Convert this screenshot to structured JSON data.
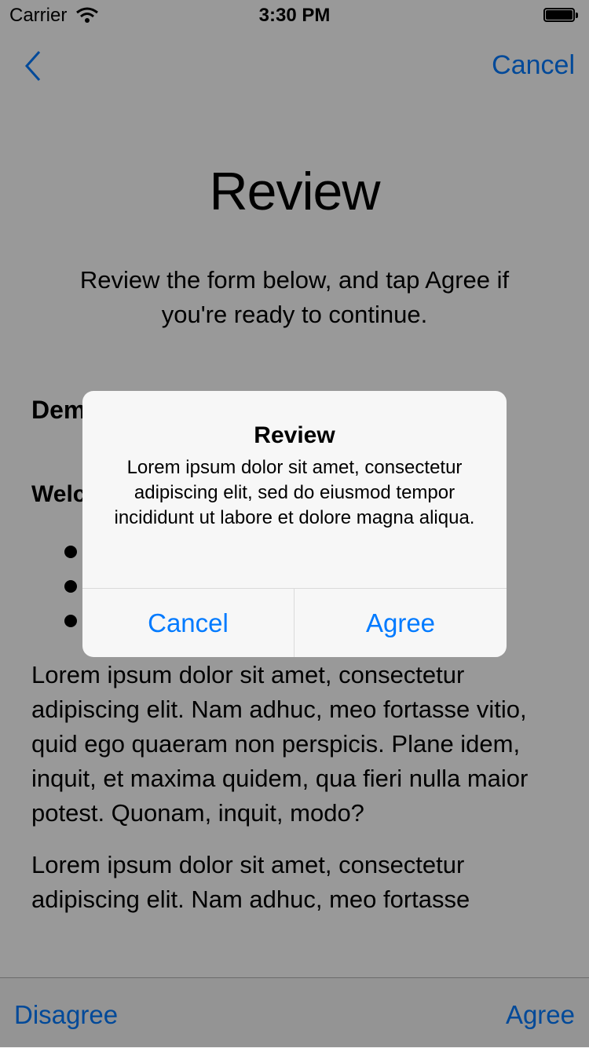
{
  "status_bar": {
    "carrier": "Carrier",
    "time": "3:30 PM"
  },
  "nav": {
    "cancel_label": "Cancel"
  },
  "page": {
    "title": "Review",
    "subtitle": "Review the form below, and tap Agree if you're ready to continue."
  },
  "content": {
    "heading": "Dem",
    "subheading": "Welc",
    "bullets": [
      "",
      "",
      ""
    ],
    "paragraph1": "Lorem ipsum dolor sit amet, consectetur adipiscing elit. Nam adhuc, meo fortasse vitio, quid ego quaeram non perspicis. Plane idem, inquit, et maxima quidem, qua fieri nulla maior potest. Quonam, inquit, modo?",
    "paragraph2": "Lorem ipsum dolor sit amet, consectetur adipiscing elit. Nam adhuc, meo fortasse"
  },
  "toolbar": {
    "disagree_label": "Disagree",
    "agree_label": "Agree"
  },
  "alert": {
    "title": "Review",
    "message": "Lorem ipsum dolor sit amet, consectetur adipiscing elit, sed do eiusmod tempor incididunt ut labore et dolore magna aliqua.",
    "cancel_label": "Cancel",
    "agree_label": "Agree"
  },
  "colors": {
    "accent": "#007aff",
    "dim_overlay": "rgba(0,0,0,0.4)"
  },
  "icons": {
    "back": "chevron-left-icon",
    "wifi": "wifi-icon",
    "battery": "battery-icon"
  }
}
